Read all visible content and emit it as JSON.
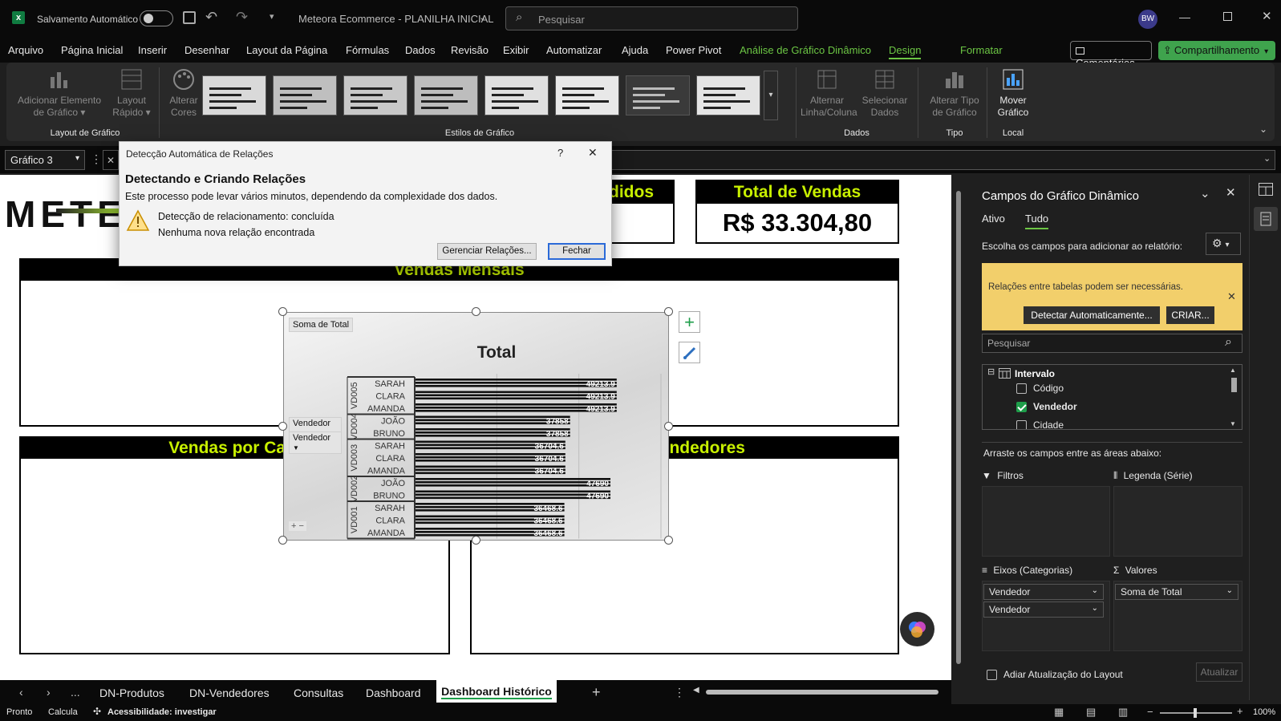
{
  "titlebar": {
    "autosave_label": "Salvamento Automático",
    "doc_title": "Meteora Ecommerce - PLANILHA INICIAL",
    "search_placeholder": "Pesquisar",
    "avatar": "BW"
  },
  "menu": {
    "items": [
      "Arquivo",
      "Página Inicial",
      "Inserir",
      "Desenhar",
      "Layout da Página",
      "Fórmulas",
      "Dados",
      "Revisão",
      "Exibir",
      "Automatizar",
      "Ajuda",
      "Power Pivot",
      "Análise de Gráfico Dinâmico",
      "Design",
      "Formatar"
    ],
    "comments": "Comentários",
    "share": "Compartilhamento"
  },
  "ribbon": {
    "add_element": "Adicionar Elemento de Gráfico",
    "quick_layout": "Layout Rápido",
    "change_colors": "Alterar Cores",
    "group_layout": "Layout de Gráfico",
    "group_styles": "Estilos de Gráfico",
    "switch_rowcol": "Alternar Linha/Coluna",
    "select_data": "Selecionar Dados",
    "group_data": "Dados",
    "change_type": "Alterar Tipo de Gráfico",
    "group_type": "Tipo",
    "move_chart": "Mover Gráfico",
    "group_location": "Local"
  },
  "namebox": "Gráfico 3",
  "dialog": {
    "title": "Detecção Automática de Relações",
    "help": "?",
    "heading": "Detectando e Criando Relações",
    "subtitle": "Este processo pode levar vários minutos, dependendo da complexidade dos dados.",
    "line1": "Detecção de relacionamento: concluída",
    "line2": "Nenhuma nova relação encontrada",
    "manage_btn": "Gerenciar Relações...",
    "close_btn": "Fechar"
  },
  "dashboard": {
    "logo": "METE",
    "pedidos_head": "didos",
    "vendas_head": "Total de Vendas",
    "vendas_value": "R$ 33.304,80",
    "mensais_head": "Vendas Mensais",
    "categoria_head": "Vendas por Cate",
    "vendedores_head": "Vendedores"
  },
  "chart": {
    "field_button": "Soma de Total",
    "title": "Total",
    "axis_btn1": "Vendedor",
    "axis_btn2": "Vendedor",
    "zoom": "+  −"
  },
  "chart_data": {
    "type": "bar",
    "title": "Total",
    "orientation": "horizontal",
    "groups": [
      {
        "group": "VD005",
        "categories": [
          "SARAH",
          "CLARA",
          "AMANDA"
        ],
        "values": [
          49213.9,
          49213.9,
          49213.9
        ]
      },
      {
        "group": "VD004",
        "categories": [
          "JOÃO",
          "BRUNO"
        ],
        "values": [
          37858,
          37858
        ]
      },
      {
        "group": "VD003",
        "categories": [
          "SARAH",
          "CLARA",
          "AMANDA"
        ],
        "values": [
          36704.6,
          36704.6,
          36704.6
        ]
      },
      {
        "group": "VD002",
        "categories": [
          "JOÃO",
          "BRUNO"
        ],
        "values": [
          47690,
          47690
        ]
      },
      {
        "group": "VD001",
        "categories": [
          "SARAH",
          "CLARA",
          "AMANDA"
        ],
        "values": [
          36468.6,
          36468.6,
          36468.6
        ]
      }
    ],
    "xlim": [
      0,
      60000
    ]
  },
  "panel": {
    "title": "Campos do Gráfico Dinâmico",
    "tab_active": "Ativo",
    "tab_all": "Tudo",
    "choose": "Escolha os campos para adicionar ao relatório:",
    "notice": "Relações entre tabelas podem ser necessárias.",
    "detect_btn": "Detectar Automaticamente...",
    "create_btn": "CRIAR...",
    "search_placeholder": "Pesquisar",
    "table_name": "Intervalo",
    "fields": [
      {
        "name": "Código",
        "checked": false
      },
      {
        "name": "Vendedor",
        "checked": true
      },
      {
        "name": "Cidade",
        "checked": false
      }
    ],
    "drag_hint": "Arraste os campos entre as áreas abaixo:",
    "filters": "Filtros",
    "legend": "Legenda (Série)",
    "axes": "Eixos (Categorias)",
    "values": "Valores",
    "axis_item1": "Vendedor",
    "axis_item2": "Vendedor",
    "value_item": "Soma de Total",
    "defer": "Adiar Atualização do Layout",
    "update": "Atualizar"
  },
  "tabs": {
    "items": [
      "DN-Produtos",
      "DN-Vendedores",
      "Consultas",
      "Dashboard",
      "Dashboard Histórico"
    ],
    "active": "Dashboard Histórico",
    "dots": "..."
  },
  "status": {
    "ready": "Pronto",
    "calc": "Calcula",
    "accessibility": "Acessibilidade: investigar",
    "zoom": "100%"
  }
}
